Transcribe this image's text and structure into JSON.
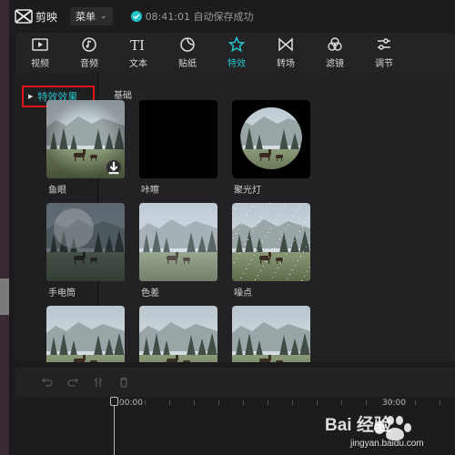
{
  "app": {
    "name": "剪映",
    "menu_label": "菜单",
    "save_status": "08:41:01 自动保存成功"
  },
  "toolbar": {
    "tabs": [
      {
        "label": "视频",
        "icon": "video-icon"
      },
      {
        "label": "音频",
        "icon": "music-icon"
      },
      {
        "label": "文本",
        "icon": "text-icon"
      },
      {
        "label": "贴纸",
        "icon": "sticker-icon"
      },
      {
        "label": "特效",
        "icon": "star-effect-icon",
        "active": true
      },
      {
        "label": "转场",
        "icon": "transition-icon"
      },
      {
        "label": "滤镜",
        "icon": "filter-icon"
      },
      {
        "label": "调节",
        "icon": "adjust-icon"
      }
    ],
    "active_color": "#27c3c9"
  },
  "sidebar": {
    "items": [
      {
        "label": "特效效果",
        "selected": true
      }
    ]
  },
  "content": {
    "section_title": "基础",
    "effects": [
      {
        "label": "鱼眼"
      },
      {
        "label": "咔嚓"
      },
      {
        "label": "聚光灯"
      },
      {
        "label": "手电筒"
      },
      {
        "label": "色差"
      },
      {
        "label": "噪点"
      },
      {
        "label": ""
      },
      {
        "label": ""
      },
      {
        "label": ""
      }
    ]
  },
  "timeline": {
    "time_start": "00:00",
    "time_mark": "30:00"
  },
  "watermark": {
    "text": "Bai 经验",
    "sub": "jingyan.baidu.com"
  }
}
